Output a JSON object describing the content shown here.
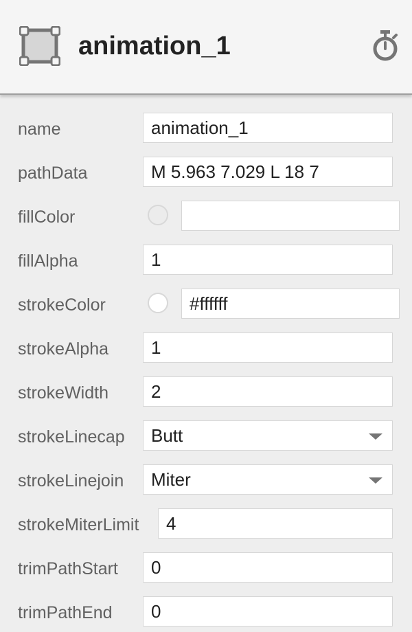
{
  "header": {
    "title": "animation_1",
    "layer_icon": "vector-layer-icon",
    "timer_icon": "stopwatch-icon"
  },
  "properties": {
    "name": {
      "label": "name",
      "value": "animation_1"
    },
    "pathData": {
      "label": "pathData",
      "value": "M 5.963 7.029 L 18 7"
    },
    "fillColor": {
      "label": "fillColor",
      "value": ""
    },
    "fillAlpha": {
      "label": "fillAlpha",
      "value": "1"
    },
    "strokeColor": {
      "label": "strokeColor",
      "value": "#ffffff"
    },
    "strokeAlpha": {
      "label": "strokeAlpha",
      "value": "1"
    },
    "strokeWidth": {
      "label": "strokeWidth",
      "value": "2"
    },
    "strokeLinecap": {
      "label": "strokeLinecap",
      "value": "Butt"
    },
    "strokeLinejoin": {
      "label": "strokeLinejoin",
      "value": "Miter"
    },
    "strokeMiterLimit": {
      "label": "strokeMiterLimit",
      "value": "4"
    },
    "trimPathStart": {
      "label": "trimPathStart",
      "value": "0"
    },
    "trimPathEnd": {
      "label": "trimPathEnd",
      "value": "0"
    }
  },
  "colors": {
    "background": "#eeeeee",
    "header_background": "#f5f5f5",
    "label_text": "#616161",
    "icon": "#757575"
  }
}
